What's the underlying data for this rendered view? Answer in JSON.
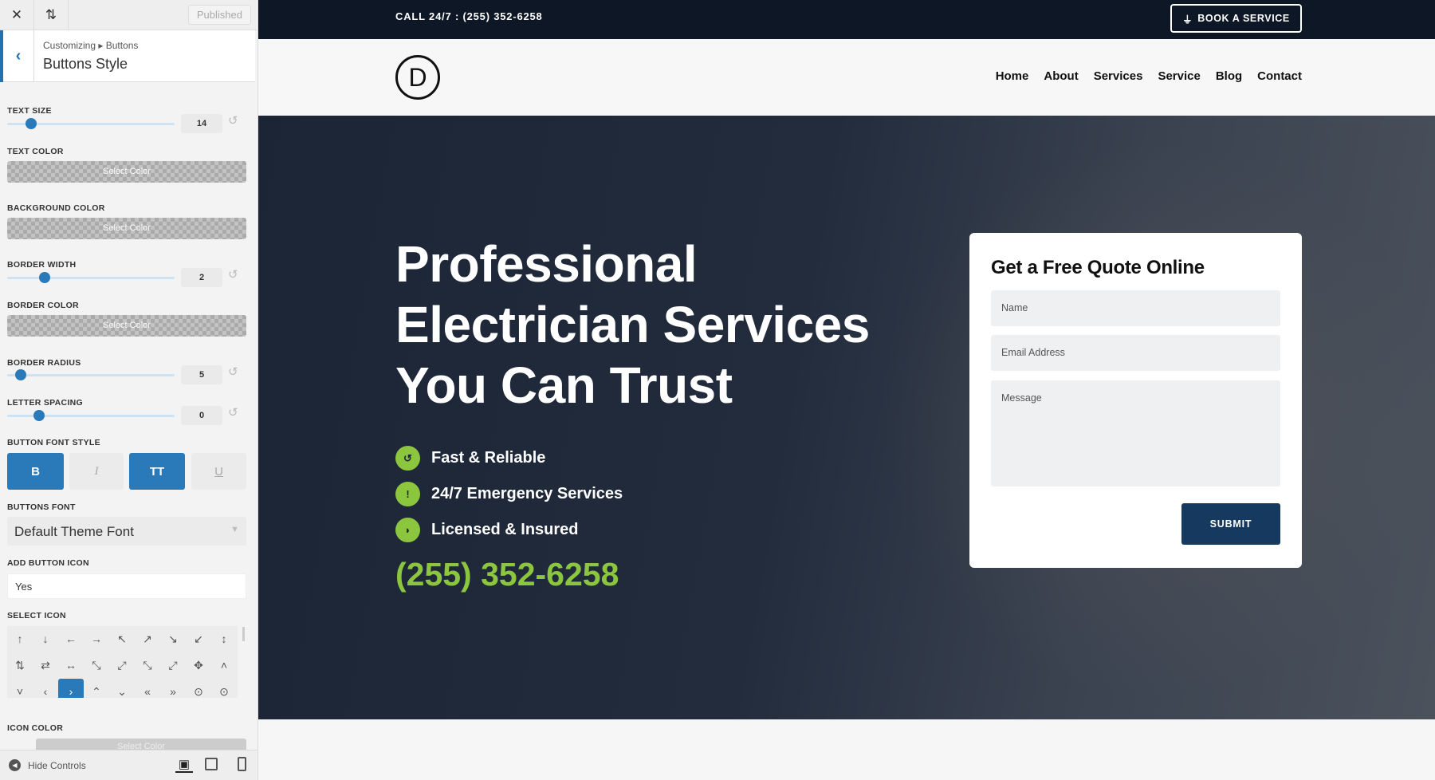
{
  "customizer": {
    "close_icon": "close-icon",
    "reorder_icon": "arrows-up-down-icon",
    "publish_label": "Published",
    "breadcrumb": "Customizing ▸ Buttons",
    "title": "Buttons Style",
    "text_size": {
      "label": "TEXT SIZE",
      "value": "14"
    },
    "text_color": {
      "label": "TEXT COLOR",
      "button": "Select Color"
    },
    "background_color": {
      "label": "BACKGROUND COLOR",
      "button": "Select Color"
    },
    "border_width": {
      "label": "BORDER WIDTH",
      "value": "2"
    },
    "border_color": {
      "label": "BORDER COLOR",
      "button": "Select Color"
    },
    "border_radius": {
      "label": "BORDER RADIUS",
      "value": "5"
    },
    "letter_spacing": {
      "label": "LETTER SPACING",
      "value": "0"
    },
    "font_style": {
      "label": "BUTTON FONT STYLE",
      "options": [
        {
          "label": "B",
          "active": true
        },
        {
          "label": "I",
          "active": false
        },
        {
          "label": "TT",
          "active": true
        },
        {
          "label": "U",
          "active": false
        }
      ]
    },
    "buttons_font": {
      "label": "BUTTONS FONT",
      "value": "Default Theme Font"
    },
    "add_icon": {
      "label": "ADD BUTTON ICON",
      "value": "Yes"
    },
    "select_icon": {
      "label": "SELECT ICON",
      "icons": [
        "↑",
        "↓",
        "←",
        "→",
        "↖",
        "↗",
        "↘",
        "↙",
        "↕",
        "⇅",
        "⇄",
        "↔",
        "⤡",
        "⤢",
        "⤡",
        "⤢",
        "✥",
        "˄",
        "˅",
        "‹",
        "›",
        "⌃",
        "⌄",
        "«",
        "»",
        "⊙",
        "⊙"
      ],
      "selected": 20
    },
    "icon_color": {
      "label": "ICON COLOR",
      "button": "Select Color"
    },
    "hide_controls": "Hide Controls",
    "accent": "#2a7ab9"
  },
  "site": {
    "topbar": {
      "call": "CALL 24/7 : (255) 352-6258",
      "book": "BOOK A SERVICE",
      "book_icon": "plug-icon"
    },
    "logo": "D",
    "nav": [
      "Home",
      "About",
      "Services",
      "Service",
      "Blog",
      "Contact"
    ],
    "hero": {
      "lines": [
        "Professional",
        "Electrician Services",
        "You Can Trust"
      ],
      "features": [
        {
          "icon": "history-icon",
          "glyph": "↺",
          "text": "Fast & Reliable"
        },
        {
          "icon": "alert-icon",
          "glyph": "!",
          "text": "24/7 Emergency Services"
        },
        {
          "icon": "shield-icon",
          "glyph": "◗",
          "text": "Licensed & Insured"
        }
      ],
      "phone": "(255) 352-6258"
    },
    "form": {
      "title": "Get a Free Quote Online",
      "name_placeholder": "Name",
      "email_placeholder": "Email Address",
      "message_placeholder": "Message",
      "submit": "SUBMIT"
    },
    "colors": {
      "dark": "#0e1726",
      "green": "#8cc63f",
      "submit": "#163a5f"
    }
  }
}
